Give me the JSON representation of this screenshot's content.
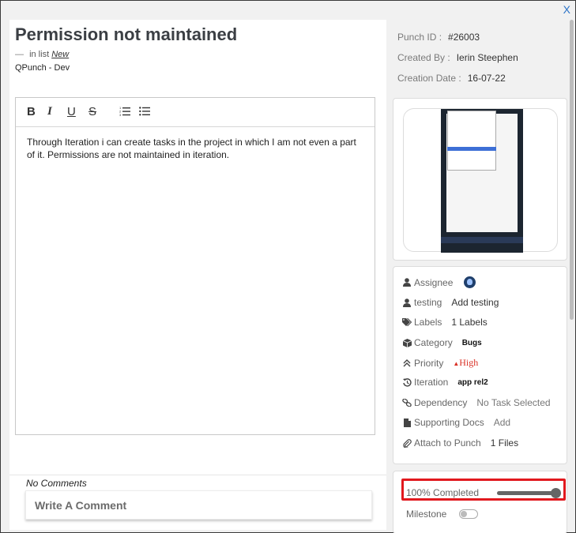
{
  "window": {
    "close_label": "X"
  },
  "task": {
    "title": "Permission not maintained",
    "list_prefix": "in list",
    "list_name": "New",
    "project": "QPunch - Dev"
  },
  "editor": {
    "toolbar": {
      "bold": "B",
      "italic": "I",
      "underline": "U",
      "strike": "S",
      "ordered_list": "☰",
      "bullet_list": "☰"
    },
    "body": "Through Iteration i can create tasks in the project in which I am not even a part of it. Permissions are not maintained in iteration."
  },
  "comments": {
    "empty_label": "No Comments",
    "placeholder": "Write A Comment"
  },
  "meta": {
    "punch_id_label": "Punch ID :",
    "punch_id": "#26003",
    "created_by_label": "Created By :",
    "created_by": "Ierin Steephen",
    "creation_date_label": "Creation Date :",
    "creation_date": "16-07-22"
  },
  "details": {
    "assignee_label": "Assignee",
    "testing_label": "testing",
    "testing_value": "Add testing",
    "labels_label": "Labels",
    "labels_value": "1 Labels",
    "category_label": "Category",
    "category_value": "Bugs",
    "priority_label": "Priority",
    "priority_value": "High",
    "iteration_label": "Iteration",
    "iteration_value": "app rel2",
    "dependency_label": "Dependency",
    "dependency_value": "No Task Selected",
    "supporting_docs_label": "Supporting Docs",
    "supporting_docs_value": "Add",
    "attach_label": "Attach to Punch",
    "attach_value": "1 Files"
  },
  "progress": {
    "label": "100% Completed",
    "percent": 100,
    "milestone_label": "Milestone",
    "milestone_on": false
  },
  "colors": {
    "accent": "#2a72c8",
    "priority_high": "#d93025",
    "highlight": "#e1191e"
  }
}
